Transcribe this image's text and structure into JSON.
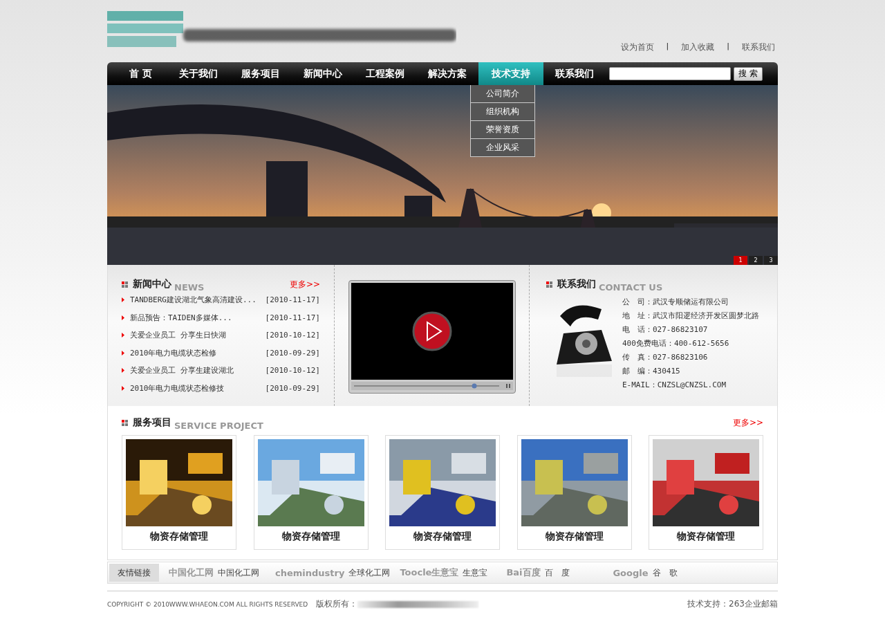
{
  "header": {
    "items": [
      {
        "kind": "link",
        "text": "设为首页"
      },
      {
        "kind": "separator",
        "text": "|"
      },
      {
        "kind": "link",
        "text": "加入收藏"
      },
      {
        "kind": "separator",
        "text": "|"
      },
      {
        "kind": "link",
        "text": "联系我们"
      }
    ]
  },
  "nav": {
    "items": [
      {
        "label": "首 页",
        "selected": false
      },
      {
        "label": "关于我们",
        "selected": false
      },
      {
        "label": "服务项目",
        "selected": false
      },
      {
        "label": "新闻中心",
        "selected": false
      },
      {
        "label": "工程案例",
        "selected": false
      },
      {
        "label": "解决方案",
        "selected": false
      },
      {
        "label": "技术支持",
        "selected": true,
        "submenu": [
          "公司简介",
          "组织机构",
          "荣誉资质",
          "企业风采"
        ]
      },
      {
        "label": "联系我们",
        "selected": false
      }
    ],
    "search_button": "搜 索"
  },
  "banner": {
    "pages": [
      {
        "label": "1",
        "selected": true
      },
      {
        "label": "2",
        "selected": false
      },
      {
        "label": "3",
        "selected": false
      }
    ]
  },
  "news": {
    "title": "新闻中心",
    "subtitle": "NEWS",
    "more": "更多>>",
    "items": [
      {
        "title": "TANDBERG建设湖北气象高清建设...",
        "date": "[2010-11-17]"
      },
      {
        "title": "新品预告：TAIDEN多媒体...",
        "date": "[2010-11-17]"
      },
      {
        "title": "关爱企业员工 分享生日快湖",
        "date": "[2010-10-12]"
      },
      {
        "title": "2010年电力电缆状态检修",
        "date": "[2010-09-29]"
      },
      {
        "title": "关爱企业员工 分享生建设湖北",
        "date": "[2010-10-12]"
      },
      {
        "title": "2010年电力电缆状态检修技",
        "date": "[2010-09-29]"
      }
    ]
  },
  "contact": {
    "title": "联系我们",
    "subtitle": "CONTACT US",
    "rows": [
      {
        "label": "公　司：",
        "value": "武汉专顺储运有限公司"
      },
      {
        "label": "地　址：",
        "value": "武汉市阳逻经济开发区圆梦北路"
      },
      {
        "label": "电　话：",
        "value": "027-86823107"
      },
      {
        "label": "400免费电话：",
        "value": "400-612-5656"
      },
      {
        "label": "传　真：",
        "value": "027-86823106"
      },
      {
        "label": "邮　编：",
        "value": "430415"
      },
      {
        "label": "E-MAIL：",
        "value": "CNZSL@CNZSL.COM"
      }
    ]
  },
  "services": {
    "title": "服务项目",
    "subtitle": "SERVICE PROJECT",
    "more": "更多>>",
    "items": [
      {
        "caption": "物资存储管理"
      },
      {
        "caption": "物资存储管理"
      },
      {
        "caption": "物资存储管理"
      },
      {
        "caption": "物资存储管理"
      },
      {
        "caption": "物资存储管理"
      }
    ]
  },
  "friend_links": {
    "label": "友情链接",
    "items": [
      {
        "logo": "中国化工网",
        "name": "中国化工网"
      },
      {
        "logo": "chemindustry",
        "name": "全球化工网"
      },
      {
        "logo": "Toocle生意宝",
        "name": "生意宝"
      },
      {
        "logo": "Bai百度",
        "name": "百　度"
      },
      {
        "logo": "Google",
        "name": "谷　歌"
      }
    ]
  },
  "footer": {
    "copyright": "COPYRIGHT © 2010WWW.WHAEON.COM ALL RIGHTS RESERVED",
    "owner_label": "版权所有：",
    "support": "技术支持：263企业邮箱"
  }
}
